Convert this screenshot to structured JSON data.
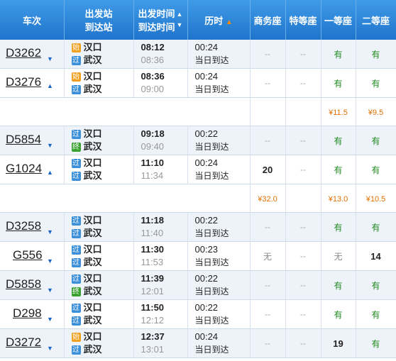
{
  "header": {
    "train": "车次",
    "stations_line1": "出发站",
    "stations_line2": "到达站",
    "times_line1": "出发时间",
    "times_line2": "到达时间",
    "duration": "历时",
    "business": "商务座",
    "special": "特等座",
    "first": "一等座",
    "second": "二等座"
  },
  "rows": [
    {
      "no": "D3262",
      "from": "汉口",
      "to": "武汉",
      "fromBadge": "始",
      "toBadge": "过",
      "dep": "08:12",
      "arr": "08:36",
      "dur": "00:24",
      "day": "当日到达",
      "biz": "--",
      "spc": "--",
      "first": "有",
      "second": "有",
      "arrow": "down"
    },
    {
      "no": "D3276",
      "from": "汉口",
      "to": "武汉",
      "fromBadge": "始",
      "toBadge": "过",
      "dep": "08:36",
      "arr": "09:00",
      "dur": "00:24",
      "day": "当日到达",
      "biz": "--",
      "spc": "--",
      "first": "有",
      "second": "有",
      "arrow": "up",
      "prices": {
        "biz": "",
        "spc": "",
        "first": "¥11.5",
        "second": "¥9.5"
      }
    },
    {
      "no": "D5854",
      "from": "汉口",
      "to": "武汉",
      "fromBadge": "过",
      "toBadge": "终",
      "dep": "09:18",
      "arr": "09:40",
      "dur": "00:22",
      "day": "当日到达",
      "biz": "--",
      "spc": "--",
      "first": "有",
      "second": "有",
      "arrow": "down"
    },
    {
      "no": "G1024",
      "from": "汉口",
      "to": "武汉",
      "fromBadge": "过",
      "toBadge": "过",
      "dep": "11:10",
      "arr": "11:34",
      "dur": "00:24",
      "day": "当日到达",
      "biz": "20",
      "spc": "--",
      "first": "有",
      "second": "有",
      "arrow": "up",
      "prices": {
        "biz": "¥32.0",
        "spc": "",
        "first": "¥13.0",
        "second": "¥10.5"
      }
    },
    {
      "no": "D3258",
      "from": "汉口",
      "to": "武汉",
      "fromBadge": "过",
      "toBadge": "过",
      "dep": "11:18",
      "arr": "11:40",
      "dur": "00:22",
      "day": "当日到达",
      "biz": "--",
      "spc": "--",
      "first": "有",
      "second": "有",
      "arrow": "down"
    },
    {
      "no": "G556",
      "from": "汉口",
      "to": "武汉",
      "fromBadge": "过",
      "toBadge": "过",
      "dep": "11:30",
      "arr": "11:53",
      "dur": "00:23",
      "day": "当日到达",
      "biz": "无",
      "spc": "--",
      "first": "无",
      "second": "14",
      "arrow": "down",
      "short": true
    },
    {
      "no": "D5858",
      "from": "汉口",
      "to": "武汉",
      "fromBadge": "过",
      "toBadge": "终",
      "dep": "11:39",
      "arr": "12:01",
      "dur": "00:22",
      "day": "当日到达",
      "biz": "--",
      "spc": "--",
      "first": "有",
      "second": "有",
      "arrow": "down"
    },
    {
      "no": "D298",
      "from": "汉口",
      "to": "武汉",
      "fromBadge": "过",
      "toBadge": "过",
      "dep": "11:50",
      "arr": "12:12",
      "dur": "00:22",
      "day": "当日到达",
      "biz": "--",
      "spc": "--",
      "first": "有",
      "second": "有",
      "arrow": "down",
      "short": true
    },
    {
      "no": "D3272",
      "from": "汉口",
      "to": "武汉",
      "fromBadge": "始",
      "toBadge": "过",
      "dep": "12:37",
      "arr": "13:01",
      "dur": "00:24",
      "day": "当日到达",
      "biz": "--",
      "spc": "--",
      "first": "19",
      "second": "有",
      "arrow": "down"
    }
  ]
}
